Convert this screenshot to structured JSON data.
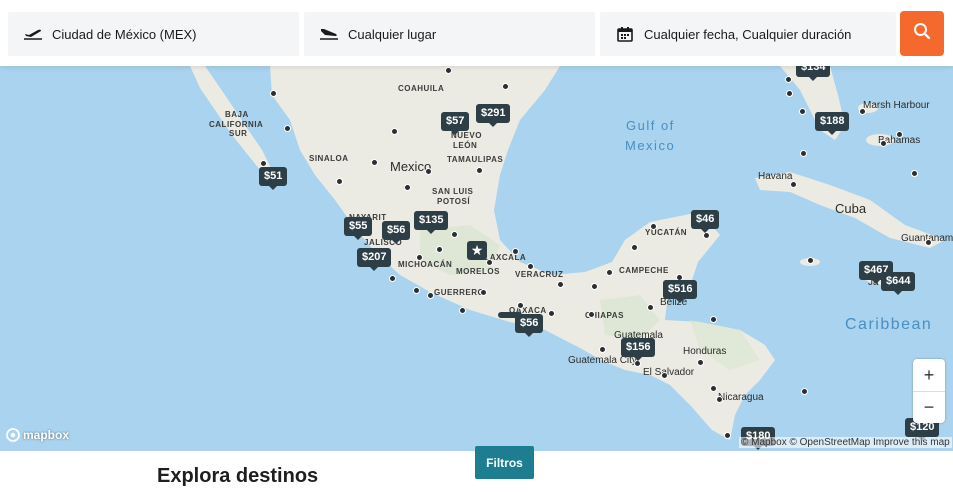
{
  "search": {
    "origin": "Ciudad de México (MEX)",
    "destination_placeholder": "Cualquier lugar",
    "dates": "Cualquier fecha, Cualquier duración"
  },
  "map": {
    "pins": [
      "$51",
      "$57",
      "$291",
      "$55",
      "$56",
      "$135",
      "$207",
      "$46",
      "$516",
      "$56",
      "$156",
      "$188",
      "$467",
      "$644",
      "$180",
      "$120",
      "$134"
    ],
    "origin_marker": "★",
    "labels": {
      "coahuila": "COAHUILA",
      "baja": "BAJA",
      "california": "CALIFORNIA",
      "sur": "SUR",
      "sinaloa": "SINALOA",
      "mexico": "Mexico",
      "nuevo": "NUEVO",
      "leon": "LEÓN",
      "tamaulipas": "TAMAULIPAS",
      "san_luis": "SAN LUIS",
      "potosi": "POTOSÍ",
      "nayarit": "NAYARIT",
      "jalisco": "JALISCO",
      "michoacan": "MICHOACÁN",
      "guerrero": "GUERRERO",
      "morelos": "MORELOS",
      "tlaxcala": "TLAXCALA",
      "veracruz": "VERACRUZ",
      "oaxaca": "OAXACA",
      "chiapas": "CHIAPAS",
      "campeche": "CAMPECHE",
      "yucatan": "YUCATÁN",
      "gulf1": "Gulf of",
      "gulf2": "Mexico",
      "marsh": "Marsh Harbour",
      "bahamas": "Bahamas",
      "havana": "Havana",
      "cuba": "Cuba",
      "guantanamo": "Guantanamo",
      "belize": "Belize",
      "guatemala": "Guatemala",
      "guatemala_city": "Guatemala City",
      "el_salvador": "El Salvador",
      "honduras": "Honduras",
      "nicaragua": "Nicaragua",
      "caribbean": "Caribbean",
      "ja": "Ja"
    },
    "zoom_in": "+",
    "zoom_out": "−",
    "logo": "mapbox",
    "attribution": "© Mapbox © OpenStreetMap Improve this map"
  },
  "filters_label": "Filtros",
  "section_title": "Explora destinos",
  "colors": {
    "accent": "#f56a2c",
    "pin": "#2d3e46",
    "filters": "#1d7e92",
    "water": "#a9d3ee",
    "land": "#ecebe3"
  }
}
